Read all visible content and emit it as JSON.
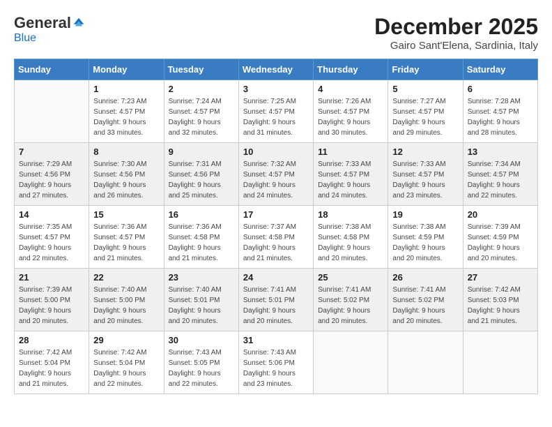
{
  "logo": {
    "general": "General",
    "blue": "Blue"
  },
  "title": "December 2025",
  "subtitle": "Gairo Sant'Elena, Sardinia, Italy",
  "weekdays": [
    "Sunday",
    "Monday",
    "Tuesday",
    "Wednesday",
    "Thursday",
    "Friday",
    "Saturday"
  ],
  "weeks": [
    [
      {
        "day": "",
        "info": ""
      },
      {
        "day": "1",
        "info": "Sunrise: 7:23 AM\nSunset: 4:57 PM\nDaylight: 9 hours\nand 33 minutes."
      },
      {
        "day": "2",
        "info": "Sunrise: 7:24 AM\nSunset: 4:57 PM\nDaylight: 9 hours\nand 32 minutes."
      },
      {
        "day": "3",
        "info": "Sunrise: 7:25 AM\nSunset: 4:57 PM\nDaylight: 9 hours\nand 31 minutes."
      },
      {
        "day": "4",
        "info": "Sunrise: 7:26 AM\nSunset: 4:57 PM\nDaylight: 9 hours\nand 30 minutes."
      },
      {
        "day": "5",
        "info": "Sunrise: 7:27 AM\nSunset: 4:57 PM\nDaylight: 9 hours\nand 29 minutes."
      },
      {
        "day": "6",
        "info": "Sunrise: 7:28 AM\nSunset: 4:57 PM\nDaylight: 9 hours\nand 28 minutes."
      }
    ],
    [
      {
        "day": "7",
        "info": "Sunrise: 7:29 AM\nSunset: 4:56 PM\nDaylight: 9 hours\nand 27 minutes."
      },
      {
        "day": "8",
        "info": "Sunrise: 7:30 AM\nSunset: 4:56 PM\nDaylight: 9 hours\nand 26 minutes."
      },
      {
        "day": "9",
        "info": "Sunrise: 7:31 AM\nSunset: 4:56 PM\nDaylight: 9 hours\nand 25 minutes."
      },
      {
        "day": "10",
        "info": "Sunrise: 7:32 AM\nSunset: 4:57 PM\nDaylight: 9 hours\nand 24 minutes."
      },
      {
        "day": "11",
        "info": "Sunrise: 7:33 AM\nSunset: 4:57 PM\nDaylight: 9 hours\nand 24 minutes."
      },
      {
        "day": "12",
        "info": "Sunrise: 7:33 AM\nSunset: 4:57 PM\nDaylight: 9 hours\nand 23 minutes."
      },
      {
        "day": "13",
        "info": "Sunrise: 7:34 AM\nSunset: 4:57 PM\nDaylight: 9 hours\nand 22 minutes."
      }
    ],
    [
      {
        "day": "14",
        "info": "Sunrise: 7:35 AM\nSunset: 4:57 PM\nDaylight: 9 hours\nand 22 minutes."
      },
      {
        "day": "15",
        "info": "Sunrise: 7:36 AM\nSunset: 4:57 PM\nDaylight: 9 hours\nand 21 minutes."
      },
      {
        "day": "16",
        "info": "Sunrise: 7:36 AM\nSunset: 4:58 PM\nDaylight: 9 hours\nand 21 minutes."
      },
      {
        "day": "17",
        "info": "Sunrise: 7:37 AM\nSunset: 4:58 PM\nDaylight: 9 hours\nand 21 minutes."
      },
      {
        "day": "18",
        "info": "Sunrise: 7:38 AM\nSunset: 4:58 PM\nDaylight: 9 hours\nand 20 minutes."
      },
      {
        "day": "19",
        "info": "Sunrise: 7:38 AM\nSunset: 4:59 PM\nDaylight: 9 hours\nand 20 minutes."
      },
      {
        "day": "20",
        "info": "Sunrise: 7:39 AM\nSunset: 4:59 PM\nDaylight: 9 hours\nand 20 minutes."
      }
    ],
    [
      {
        "day": "21",
        "info": "Sunrise: 7:39 AM\nSunset: 5:00 PM\nDaylight: 9 hours\nand 20 minutes."
      },
      {
        "day": "22",
        "info": "Sunrise: 7:40 AM\nSunset: 5:00 PM\nDaylight: 9 hours\nand 20 minutes."
      },
      {
        "day": "23",
        "info": "Sunrise: 7:40 AM\nSunset: 5:01 PM\nDaylight: 9 hours\nand 20 minutes."
      },
      {
        "day": "24",
        "info": "Sunrise: 7:41 AM\nSunset: 5:01 PM\nDaylight: 9 hours\nand 20 minutes."
      },
      {
        "day": "25",
        "info": "Sunrise: 7:41 AM\nSunset: 5:02 PM\nDaylight: 9 hours\nand 20 minutes."
      },
      {
        "day": "26",
        "info": "Sunrise: 7:41 AM\nSunset: 5:02 PM\nDaylight: 9 hours\nand 20 minutes."
      },
      {
        "day": "27",
        "info": "Sunrise: 7:42 AM\nSunset: 5:03 PM\nDaylight: 9 hours\nand 21 minutes."
      }
    ],
    [
      {
        "day": "28",
        "info": "Sunrise: 7:42 AM\nSunset: 5:04 PM\nDaylight: 9 hours\nand 21 minutes."
      },
      {
        "day": "29",
        "info": "Sunrise: 7:42 AM\nSunset: 5:04 PM\nDaylight: 9 hours\nand 22 minutes."
      },
      {
        "day": "30",
        "info": "Sunrise: 7:43 AM\nSunset: 5:05 PM\nDaylight: 9 hours\nand 22 minutes."
      },
      {
        "day": "31",
        "info": "Sunrise: 7:43 AM\nSunset: 5:06 PM\nDaylight: 9 hours\nand 23 minutes."
      },
      {
        "day": "",
        "info": ""
      },
      {
        "day": "",
        "info": ""
      },
      {
        "day": "",
        "info": ""
      }
    ]
  ]
}
